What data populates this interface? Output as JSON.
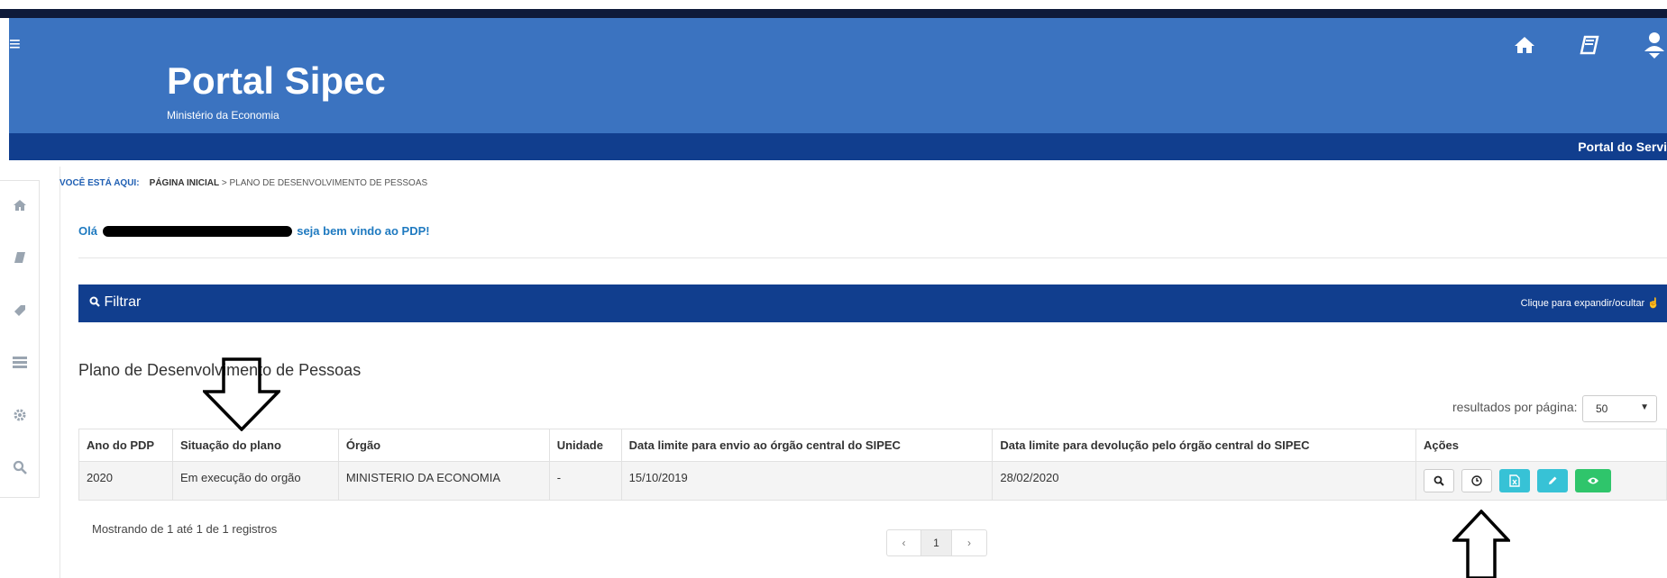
{
  "header": {
    "title": "Portal Sipec",
    "subtitle": "Ministério da Economia",
    "menu_icon": "hamburger-icon",
    "icons": [
      "home-icon",
      "book-icon",
      "user-icon"
    ],
    "navbar_text": "Portal do Servi"
  },
  "breadcrumb": {
    "here_label": "VOCÊ ESTÁ AQUI:",
    "home": "PÁGINA INICIAL",
    "separator": ">",
    "current": "PLANO DE DESENVOLVIMENTO DE PESSOAS"
  },
  "greeting": {
    "prefix": "Olá",
    "suffix": "seja bem vindo ao PDP!"
  },
  "filter": {
    "label": "Filtrar",
    "toggle_text": "Clique para expandir/ocultar"
  },
  "section_title": "Plano de Desenvolvimento de Pessoas",
  "per_page": {
    "label": "resultados por página:",
    "value": "50"
  },
  "table": {
    "headers": [
      "Ano do PDP",
      "Situação do plano",
      "Órgão",
      "Unidade",
      "Data limite para envio ao órgão central do SIPEC",
      "Data limite para devolução pelo órgão central do SIPEC",
      "Ações"
    ],
    "rows": [
      [
        "2020",
        "Em execução do orgão",
        "MINISTERIO DA ECONOMIA",
        "-",
        "15/10/2019",
        "28/02/2020"
      ]
    ]
  },
  "footer": {
    "showing": "Mostrando de 1 até 1 de 1 registros",
    "pager_prev": "‹",
    "pager_page": "1",
    "pager_next": "›"
  },
  "colors": {
    "header_blue": "#3b73c0",
    "navy": "#113e8e",
    "teal": "#37c2d6",
    "green": "#2fc56b"
  }
}
